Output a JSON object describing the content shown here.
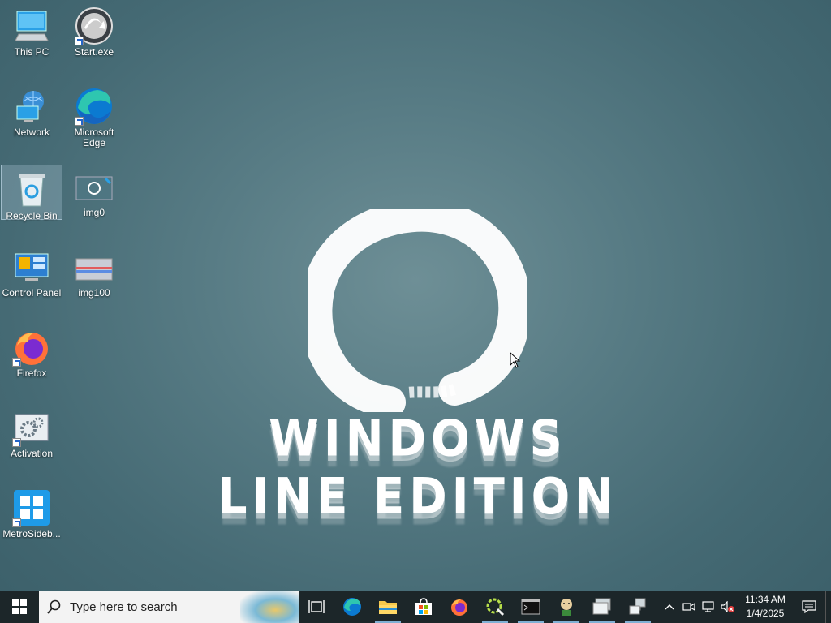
{
  "desktop_icons": [
    {
      "label": "This PC"
    },
    {
      "label": "Start.exe"
    },
    {
      "label": "Network"
    },
    {
      "label": "Microsoft Edge"
    },
    {
      "label": "Recycle Bin"
    },
    {
      "label": "img0"
    },
    {
      "label": "Control Panel"
    },
    {
      "label": "img100"
    },
    {
      "label": "Firefox"
    },
    {
      "label": "Activation"
    },
    {
      "label": "MetroSideb..."
    }
  ],
  "wallpaper": {
    "brand_text": "WINDOWS LINE EDITION"
  },
  "taskbar": {
    "search_placeholder": "Type here to search",
    "pinned": [
      {
        "icon": "task-view-icon"
      },
      {
        "icon": "edge-icon"
      },
      {
        "icon": "file-explorer-icon"
      },
      {
        "icon": "store-icon"
      },
      {
        "icon": "firefox-icon"
      },
      {
        "icon": "tool-app-icon"
      },
      {
        "icon": "terminal-icon"
      },
      {
        "icon": "avatar-app-icon"
      },
      {
        "icon": "window-app-icon"
      },
      {
        "icon": "network-app-icon"
      }
    ],
    "tray": {
      "chevron": "^",
      "time": "11:34 AM",
      "date": "1/4/2025"
    }
  },
  "colors": {
    "taskbar": "#1c2629",
    "accent": "#7fb0d4"
  }
}
